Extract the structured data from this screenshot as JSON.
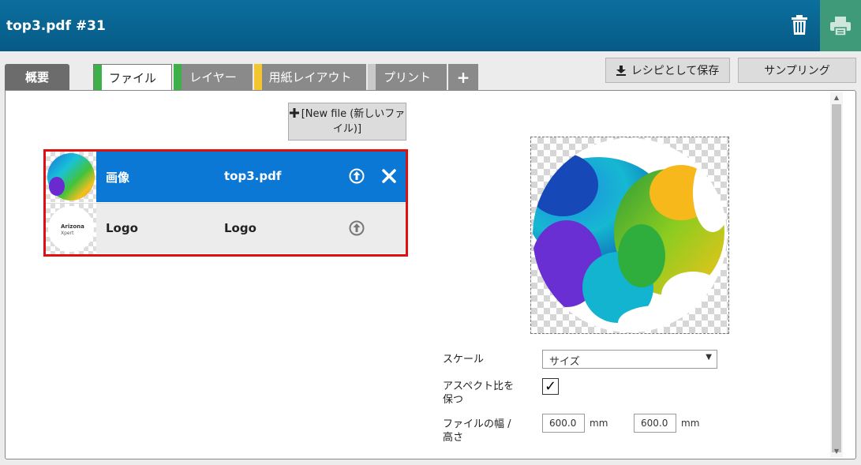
{
  "header": {
    "title": "top3.pdf #31",
    "trash_icon": "trash-icon",
    "print_icon": "printer-icon",
    "print_bg": "#3f9a7a"
  },
  "tabs": [
    {
      "label": "概要",
      "color": ""
    },
    {
      "label": "ファイル",
      "color": "#3db04a"
    },
    {
      "label": "レイヤー",
      "color": "#3db04a"
    },
    {
      "label": "用紙レイアウト",
      "color": "#f2c531"
    },
    {
      "label": "プリント",
      "color": "#c9c9c9"
    },
    {
      "label": "+",
      "color": ""
    }
  ],
  "toolbar": {
    "save_label": "レシピとして保存",
    "sampling_label": "サンプリング"
  },
  "new_file_label": "[New file (新しいファイル)]",
  "files": [
    {
      "name": "画像",
      "file": "top3.pdf",
      "selected": true
    },
    {
      "name": "Logo",
      "file": "Logo",
      "selected": false,
      "thumb_text_1": "Arizona",
      "thumb_text_2": "Xpert"
    }
  ],
  "settings": {
    "scale_label": "スケール",
    "scale_value": "サイズ",
    "aspect_label": "アスペクト比を保つ",
    "aspect_checked": true,
    "size_label": "ファイルの幅 / 高さ",
    "width": "600.0",
    "height": "600.0",
    "unit": "mm"
  },
  "colors": {
    "header": "#0b6f9e",
    "selected_row": "#0b78d6",
    "highlight_border": "#e01010"
  }
}
